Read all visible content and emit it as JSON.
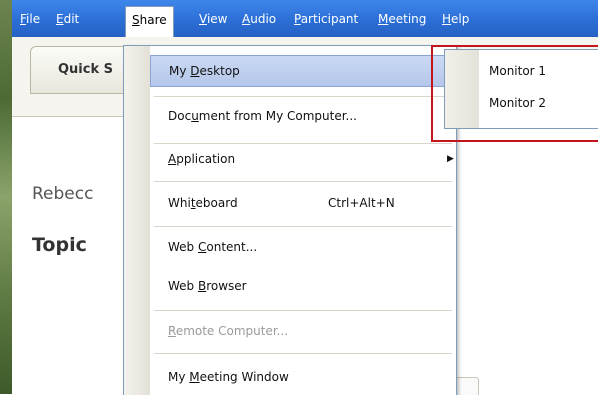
{
  "menubar": {
    "items": [
      {
        "label": "File",
        "underline": "F"
      },
      {
        "label": "Edit",
        "underline": "E"
      },
      {
        "label": "Share",
        "underline": "S",
        "active": true
      },
      {
        "label": "View",
        "underline": "V"
      },
      {
        "label": "Audio",
        "underline": "A"
      },
      {
        "label": "Participant",
        "underline": "P"
      },
      {
        "label": "Meeting",
        "underline": "M"
      },
      {
        "label": "Help",
        "underline": "H"
      }
    ]
  },
  "background": {
    "quick_tab_label": "Quick S",
    "text_line1": "Rebecc",
    "text_line2": "Topic"
  },
  "share_menu": {
    "items": [
      {
        "label_pre": "My ",
        "label_ul": "D",
        "label_post": "esktop",
        "highlighted": true
      },
      {
        "label_pre": "Doc",
        "label_ul": "u",
        "label_post": "ment from My Computer..."
      },
      {
        "label_pre": "",
        "label_ul": "A",
        "label_post": "pplication",
        "has_submenu": true
      },
      {
        "label_pre": "Whi",
        "label_ul": "t",
        "label_post": "eboard",
        "shortcut": "Ctrl+Alt+N"
      },
      {
        "label_pre": "Web ",
        "label_ul": "C",
        "label_post": "ontent..."
      },
      {
        "label_pre": "Web ",
        "label_ul": "B",
        "label_post": "rowser"
      },
      {
        "label_pre": "",
        "label_ul": "R",
        "label_post": "emote Computer...",
        "disabled": true
      },
      {
        "label_pre": "My ",
        "label_ul": "M",
        "label_post": "eeting Window"
      }
    ]
  },
  "desktop_submenu": {
    "items": [
      "Monitor 1",
      "Monitor 2"
    ]
  },
  "colors": {
    "menubar": "#2b6fd6",
    "highlight": "#b4c7ea",
    "callout_border": "#c2161c"
  }
}
